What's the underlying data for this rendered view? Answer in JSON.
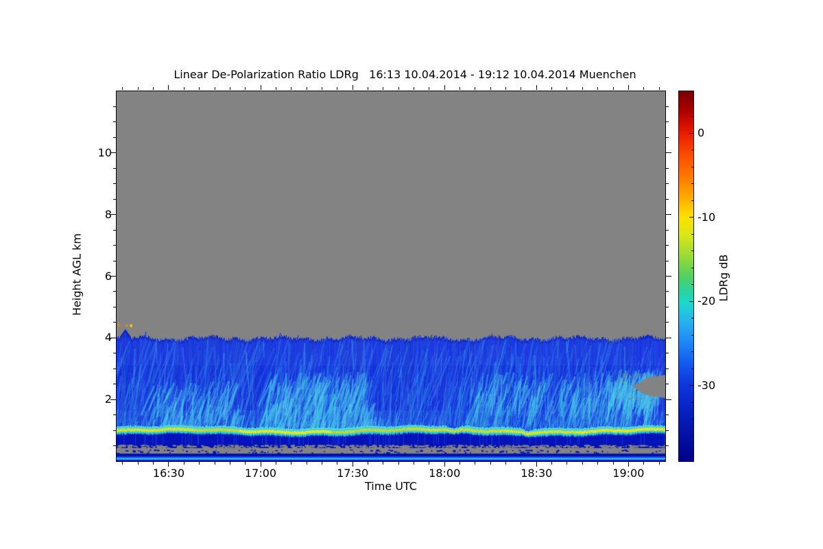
{
  "chart_data": {
    "type": "heatmap",
    "title": "Linear De-Polarization Ratio LDRg   16:13 10.04.2014 - 19:12 10.04.2014 Muenchen",
    "instrument_quantity": "Linear De-Polarization Ratio LDRg",
    "time_start": "16:13 10.04.2014",
    "time_end": "19:12 10.04.2014",
    "site": "Muenchen",
    "x_axis": {
      "label": "Time UTC",
      "start_hhmm": "16:13",
      "end_hhmm": "19:12",
      "duration_min": 179,
      "major_ticks": [
        {
          "label": "16:30",
          "min": 17
        },
        {
          "label": "17:00",
          "min": 47
        },
        {
          "label": "17:30",
          "min": 77
        },
        {
          "label": "18:00",
          "min": 107
        },
        {
          "label": "18:30",
          "min": 137
        },
        {
          "label": "19:00",
          "min": 167
        }
      ],
      "minor_step_min": 5
    },
    "y_axis": {
      "label": "Height AGL km",
      "min": 0,
      "max": 12,
      "major_ticks": [
        2,
        4,
        6,
        8,
        10
      ],
      "minor_step_km": 0.5
    },
    "colorbar": {
      "label": "LDRg dB",
      "vmax": 5,
      "vmin": -39,
      "ticks": [
        0,
        -10,
        -20,
        -30
      ],
      "minor_step_db": 2,
      "gradient_top_to_bottom": [
        {
          "p": 0.0,
          "c": "#7a0000"
        },
        {
          "p": 0.05,
          "c": "#a80000"
        },
        {
          "p": 0.09,
          "c": "#d40e00"
        },
        {
          "p": 0.115,
          "c": "#ea1e00"
        },
        {
          "p": 0.17,
          "c": "#fb4a00"
        },
        {
          "p": 0.23,
          "c": "#ff7800"
        },
        {
          "p": 0.29,
          "c": "#ffae00"
        },
        {
          "p": 0.34,
          "c": "#ffe000"
        },
        {
          "p": 0.39,
          "c": "#d9e618"
        },
        {
          "p": 0.45,
          "c": "#94da3a"
        },
        {
          "p": 0.5,
          "c": "#52cf62"
        },
        {
          "p": 0.545,
          "c": "#25d4a4"
        },
        {
          "p": 0.573,
          "c": "#1cd8cc"
        },
        {
          "p": 0.62,
          "c": "#27b4ee"
        },
        {
          "p": 0.68,
          "c": "#1e86f6"
        },
        {
          "p": 0.74,
          "c": "#1257ee"
        },
        {
          "p": 0.795,
          "c": "#0d35dc"
        },
        {
          "p": 0.87,
          "c": "#071fbe"
        },
        {
          "p": 1.0,
          "c": "#000089"
        }
      ]
    },
    "colors": {
      "background": "#ffffff",
      "no_data_gray": "#838383",
      "cloud_base_blue": "#102cd4",
      "cloud_top_edge": "#0b23c0",
      "streaks": [
        "#2e6cee",
        "#3f8cf0",
        "#38b0ea",
        "#43d2e6"
      ],
      "band_cyan": "#37cfd4",
      "band_top_edge": "#62dff0",
      "band_lower_edge": "#18b0d8",
      "sub_band_navy": "#0412ba",
      "axis": "#000000"
    },
    "features": {
      "cloud_top_km": 3.98,
      "cloud_top_spike": {
        "m0": 1.0,
        "m1": 4.5,
        "km": 4.28
      },
      "bright_band_center_km": 0.98,
      "bright_band_half_width_km": 0.11,
      "band_strength_segments": [
        {
          "m0": 0,
          "m1": 25,
          "s": 0.78
        },
        {
          "m0": 25,
          "m1": 40,
          "s": 0.62
        },
        {
          "m0": 40,
          "m1": 70,
          "s": 0.92
        },
        {
          "m0": 70,
          "m1": 95,
          "s": 0.55
        },
        {
          "m0": 95,
          "m1": 125,
          "s": 0.65
        },
        {
          "m0": 125,
          "m1": 150,
          "s": 0.78
        },
        {
          "m0": 150,
          "m1": 179,
          "s": 0.9
        }
      ],
      "band_dips": [
        {
          "m": 110,
          "w": 2.5,
          "drop": 0.07
        },
        {
          "m": 134,
          "w": 2.0,
          "drop": 0.05
        }
      ],
      "streak_patches": [
        {
          "m0": 12,
          "m1": 42,
          "km0": 1.3,
          "km1": 2.6,
          "n": 160
        },
        {
          "m0": 50,
          "m1": 82,
          "km0": 1.8,
          "km1": 2.9,
          "n": 220
        },
        {
          "m0": 47,
          "m1": 87,
          "km0": 1.15,
          "km1": 1.9,
          "n": 160
        },
        {
          "m0": 117,
          "m1": 177,
          "km0": 1.8,
          "km1": 2.9,
          "n": 260
        },
        {
          "m0": 160,
          "m1": 178,
          "km0": 2.2,
          "km1": 3.0,
          "n": 120
        }
      ],
      "orange_specks": [
        {
          "m": 0.6,
          "km": 4.47,
          "color": "#ff7b00",
          "w": 2,
          "h": 5
        },
        {
          "m": 3.1,
          "km": 4.44,
          "color": "#ff8c00",
          "w": 2,
          "h": 4
        },
        {
          "m": 4.4,
          "km": 4.44,
          "color": "#ffd400",
          "w": 3,
          "h": 4
        }
      ],
      "gray_gap": {
        "m0": 169,
        "m1": 179,
        "km0": 2.05,
        "km1": 2.8
      },
      "surface_stripes": [
        {
          "km0": 0.535,
          "km1": 0.423,
          "type": "navy_with_gray_dashes",
          "base": "#0110b2"
        },
        {
          "km0": 0.423,
          "km1": 0.245,
          "type": "gray_with_navy_dashes",
          "base": "#838383"
        },
        {
          "km0": 0.245,
          "km1": 0.156,
          "type": "solid",
          "base": "#000eb4"
        },
        {
          "km0": 0.156,
          "km1": 0.111,
          "type": "solid",
          "base": "#2144e4"
        },
        {
          "km0": 0.111,
          "km1": 0.045,
          "type": "solid",
          "base": "#28b2f4"
        },
        {
          "km0": 0.045,
          "km1": 0.0,
          "type": "solid",
          "base": "#0b18c4"
        }
      ]
    }
  }
}
